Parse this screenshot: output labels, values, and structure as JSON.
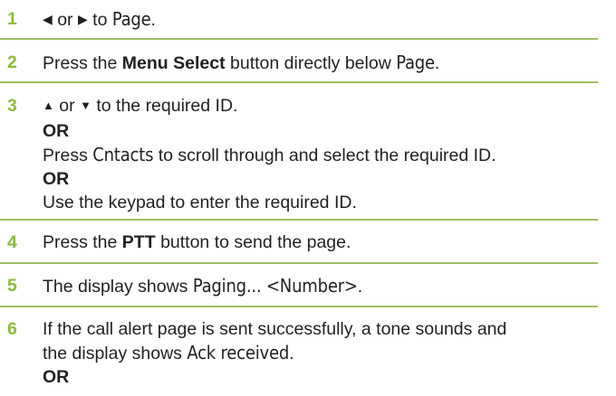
{
  "colors": {
    "step_number": "#8dba3a",
    "rule": "#9cbf62"
  },
  "icons": {
    "left": "left-triangle-icon",
    "right": "right-triangle-icon",
    "up": "up-triangle-icon",
    "down": "down-triangle-icon"
  },
  "steps": [
    {
      "number": "1",
      "or": "or",
      "to": "to",
      "page": "Page",
      "end": "."
    },
    {
      "number": "2",
      "press": "Press the",
      "menu_select": "Menu Select",
      "button_below": "button directly below",
      "page": "Page",
      "end": "."
    },
    {
      "number": "3",
      "or": "or",
      "to_required": "to the required ID.",
      "or1": "OR",
      "press": "Press",
      "cntacts": "Cntacts",
      "scroll": "to scroll through and select the required ID.",
      "or2": "OR",
      "keypad": "Use the keypad to enter the required ID."
    },
    {
      "number": "4",
      "press": "Press the",
      "ptt": "PTT",
      "rest": "button to send the page."
    },
    {
      "number": "5",
      "display": "The display shows",
      "paging": "Paging... <Number>",
      "end": "."
    },
    {
      "number": "6",
      "line1": "If the call alert page is sent successfully, a tone sounds and",
      "line2": "the display shows",
      "ack": "Ack received",
      "end": ".",
      "or": "OR"
    }
  ]
}
